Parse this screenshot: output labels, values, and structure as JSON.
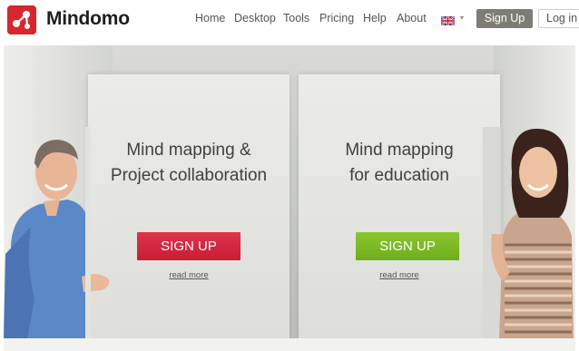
{
  "brand": {
    "name": "Mindomo"
  },
  "nav": {
    "items": [
      "Home",
      "Desktop",
      "Tools",
      "Pricing",
      "Help",
      "About"
    ],
    "language_icon": "uk-flag-icon",
    "signup_label": "Sign Up",
    "login_label": "Log in"
  },
  "hero": {
    "left": {
      "title_line1": "Mind mapping &",
      "title_line2": "Project collaboration",
      "button": "SIGN UP",
      "read_more": "read more",
      "button_color": "#d42a40"
    },
    "right": {
      "title_line1": "Mind mapping",
      "title_line2": "for education",
      "button": "SIGN UP",
      "read_more": "read more",
      "button_color": "#7cb928"
    }
  },
  "colors": {
    "brand_red": "#d7262e",
    "signup_grey": "#7d7d75"
  }
}
